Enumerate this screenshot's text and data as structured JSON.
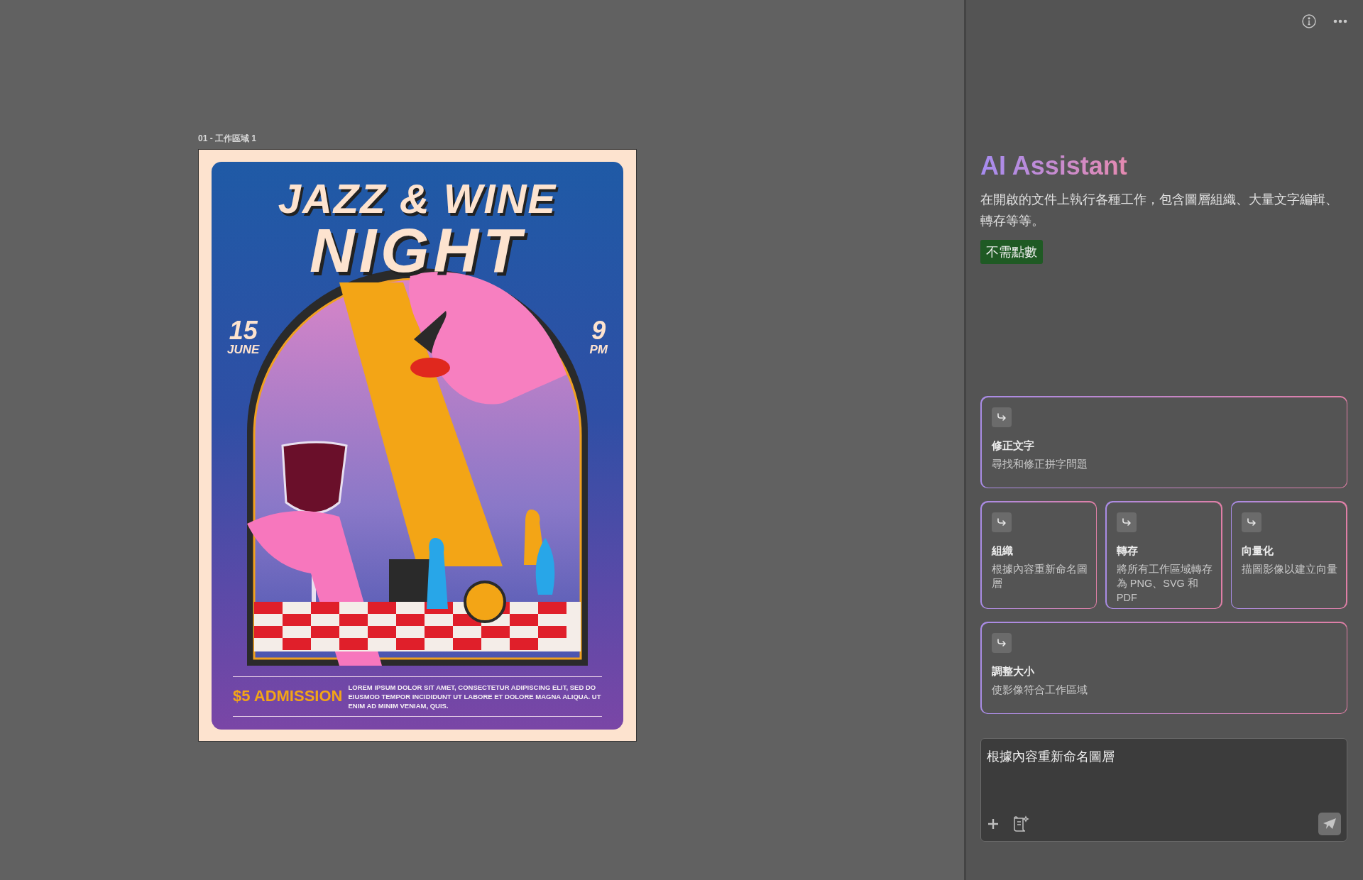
{
  "artboard": {
    "label": "01 - 工作區域 1"
  },
  "poster": {
    "title_top": "JAZZ & WINE",
    "title_main": "NIGHT",
    "date_day": "15",
    "date_month": "JUNE",
    "time_hour": "9",
    "time_suffix": "PM",
    "admission": "$5 ADMISSION",
    "body": "LOREM IPSUM DOLOR SIT AMET, CONSECTETUR ADIPISCING ELIT, SED DO EIUSMOD TEMPOR INCIDIDUNT UT LABORE ET DOLORE MAGNA ALIQUA. UT ENIM AD MINIM VENIAM, QUIS."
  },
  "panel": {
    "title": "AI Assistant",
    "description": "在開啟的文件上執行各種工作，包含圖層組織、大量文字編輯、轉存等等。",
    "badge": "不需點數",
    "suggestions": [
      {
        "title": "修正文字",
        "description": "尋找和修正拼字問題",
        "kind": "wide"
      },
      {
        "title": "組織",
        "description": "根據內容重新命名圖層",
        "kind": "narrow"
      },
      {
        "title": "轉存",
        "description": "將所有工作區域轉存為 PNG、SVG 和 PDF",
        "kind": "narrow"
      },
      {
        "title": "向量化",
        "description": "描圖影像以建立向量",
        "kind": "narrow"
      },
      {
        "title": "調整大小",
        "description": "使影像符合工作區域",
        "kind": "wide"
      }
    ],
    "prompt": {
      "value": "根據內容重新命名圖層"
    }
  }
}
